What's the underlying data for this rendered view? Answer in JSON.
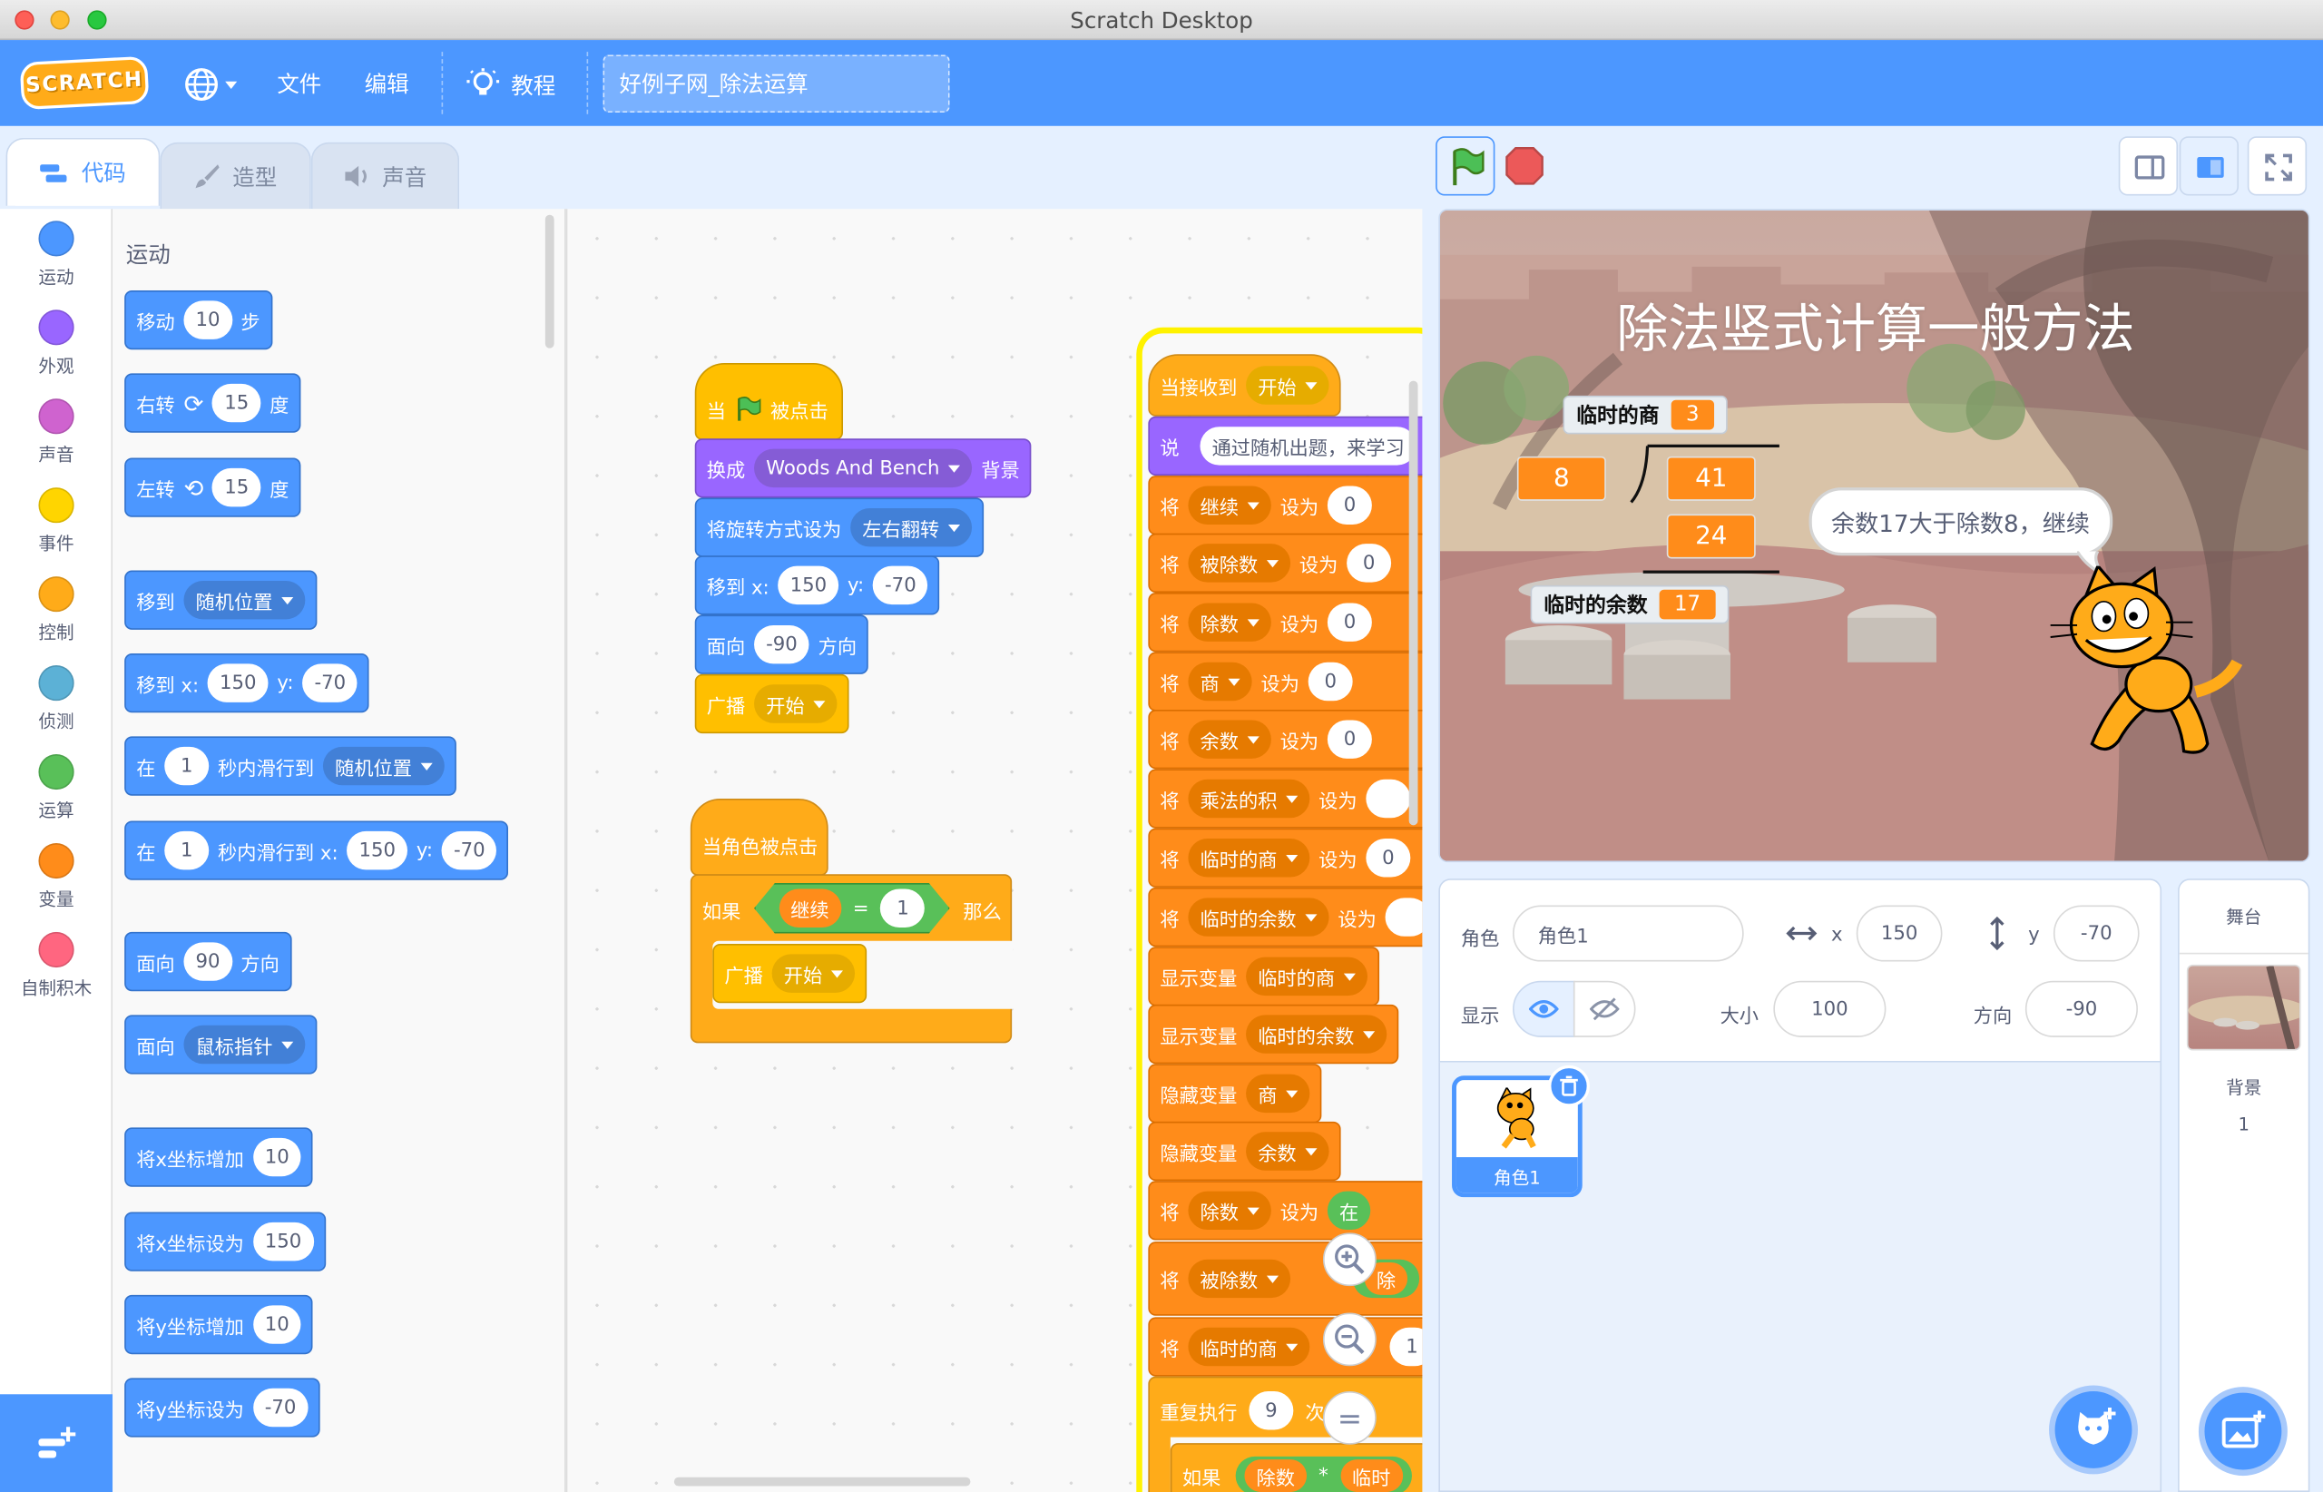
{
  "window": {
    "title": "Scratch Desktop"
  },
  "menu": {
    "logo": "SCRATCH",
    "file": "文件",
    "edit": "编辑",
    "tutorial": "教程",
    "project_title": "好例子网_除法运算"
  },
  "tabs": {
    "code": "代码",
    "costumes": "造型",
    "sounds": "声音"
  },
  "categories": [
    {
      "label": "运动",
      "color": "#4c97ff"
    },
    {
      "label": "外观",
      "color": "#9966ff"
    },
    {
      "label": "声音",
      "color": "#cf63cf"
    },
    {
      "label": "事件",
      "color": "#ffd500"
    },
    {
      "label": "控制",
      "color": "#ffab19"
    },
    {
      "label": "侦测",
      "color": "#5cb1d6"
    },
    {
      "label": "运算",
      "color": "#59c059"
    },
    {
      "label": "变量",
      "color": "#ff8c1a"
    },
    {
      "label": "自制积木",
      "color": "#ff6680"
    }
  ],
  "palette": {
    "heading": "运动",
    "move": {
      "a": "移动",
      "v": "10",
      "b": "步"
    },
    "turn_right": {
      "a": "右转",
      "v": "15",
      "b": "度"
    },
    "turn_left": {
      "a": "左转",
      "v": "15",
      "b": "度"
    },
    "goto": {
      "a": "移到",
      "dd": "随机位置"
    },
    "goto_xy": {
      "a": "移到 x:",
      "x": "150",
      "yl": "y:",
      "y": "-70"
    },
    "glide": {
      "a": "在",
      "v": "1",
      "b": "秒内滑行到",
      "dd": "随机位置"
    },
    "glide_xy": {
      "a": "在",
      "v": "1",
      "b": "秒内滑行到 x:",
      "x": "150",
      "yl": "y:",
      "y": "-70"
    },
    "point_dir": {
      "a": "面向",
      "v": "90",
      "b": "方向"
    },
    "point_towards": {
      "a": "面向",
      "dd": "鼠标指针"
    },
    "change_x": {
      "a": "将x坐标增加",
      "v": "10"
    },
    "set_x": {
      "a": "将x坐标设为",
      "v": "150"
    },
    "change_y": {
      "a": "将y坐标增加",
      "v": "10"
    },
    "set_y": {
      "a": "将y坐标设为",
      "v": "-70"
    }
  },
  "script1": {
    "hat_a": "当",
    "hat_b": "被点击",
    "backdrop": {
      "a": "换成",
      "dd": "Woods And Bench",
      "b": "背景"
    },
    "rotation": {
      "a": "将旋转方式设为",
      "dd": "左右翻转"
    },
    "goto": {
      "a": "移到 x:",
      "x": "150",
      "yl": "y:",
      "y": "-70"
    },
    "dir": {
      "a": "面向",
      "v": "-90",
      "b": "方向"
    },
    "broadcast": {
      "a": "广播",
      "dd": "开始"
    }
  },
  "script2": {
    "hat": "当角色被点击",
    "if_a": "如果",
    "var": "继续",
    "eq": "=",
    "val": "1",
    "then": "那么",
    "broadcast": {
      "a": "广播",
      "dd": "开始"
    }
  },
  "script3": {
    "hat": {
      "a": "当接收到",
      "dd": "开始"
    },
    "say": {
      "a": "说",
      "v": "通过随机出题，来学习"
    },
    "rows": [
      {
        "a": "将",
        "dd": "继续",
        "b": "设为",
        "v": "0"
      },
      {
        "a": "将",
        "dd": "被除数",
        "b": "设为",
        "v": "0"
      },
      {
        "a": "将",
        "dd": "除数",
        "b": "设为",
        "v": "0"
      },
      {
        "a": "将",
        "dd": "商",
        "b": "设为",
        "v": "0"
      },
      {
        "a": "将",
        "dd": "余数",
        "b": "设为",
        "v": "0"
      },
      {
        "a": "将",
        "dd": "乘法的积",
        "b": "设为",
        "v": ""
      },
      {
        "a": "将",
        "dd": "临时的商",
        "b": "设为",
        "v": "0"
      },
      {
        "a": "将",
        "dd": "临时的余数",
        "b": "设为",
        "v": ""
      }
    ],
    "show1": {
      "a": "显示变量",
      "dd": "临时的商"
    },
    "show2": {
      "a": "显示变量",
      "dd": "临时的余数"
    },
    "hide1": {
      "a": "隐藏变量",
      "dd": "商"
    },
    "hide2": {
      "a": "隐藏变量",
      "dd": "余数"
    },
    "set_div": {
      "a": "将",
      "dd": "除数",
      "b": "设为",
      "v": "在"
    },
    "set_dividend": {
      "a": "将",
      "dd": "被除数",
      "v": "除"
    },
    "set_tmpq": {
      "a": "将",
      "dd": "临时的商",
      "v": "1"
    },
    "repeat": {
      "a": "重复执行",
      "v": "9",
      "b": "次"
    },
    "if_row": {
      "a": "如果",
      "v1": "除数",
      "op": "*",
      "v2": "临时"
    }
  },
  "zoom": {
    "reset": "="
  },
  "stage": {
    "title": "除法竖式计算一般方法",
    "mon_q": {
      "label": "临时的商",
      "value": "3"
    },
    "mon_r": {
      "label": "临时的余数",
      "value": "17"
    },
    "divisor": "8",
    "dividend": "41",
    "product": "24",
    "bubble": "余数17大于除数8，继续"
  },
  "sprite": {
    "label_sprite": "角色",
    "name": "角色1",
    "x_label": "x",
    "x": "150",
    "y_label": "y",
    "y": "-70",
    "show_label": "显示",
    "size_label": "大小",
    "size": "100",
    "dir_label": "方向",
    "dir": "-90",
    "thumb_name": "角色1"
  },
  "stage_panel": {
    "title": "舞台",
    "backdrops_label": "背景",
    "backdrops_count": "1"
  }
}
